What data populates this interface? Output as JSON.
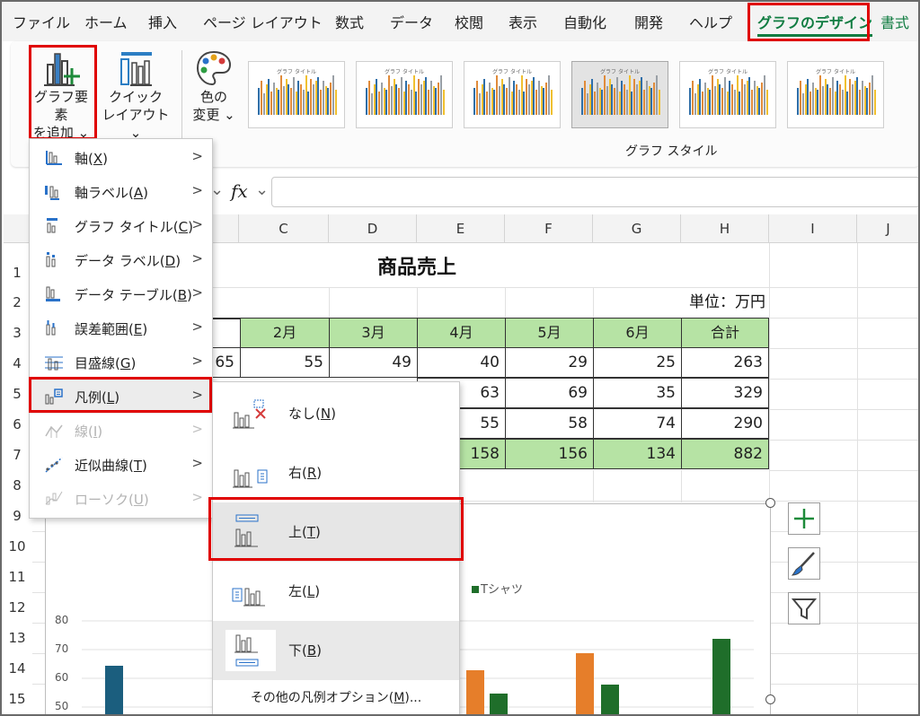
{
  "ribbon_tabs": [
    "ファイル",
    "ホーム",
    "挿入",
    "ページ レイアウト",
    "数式",
    "データ",
    "校閲",
    "表示",
    "自動化",
    "開発",
    "ヘルプ",
    "グラフのデザイン",
    "書式"
  ],
  "ribbon": {
    "add_element": [
      "グラフ要素",
      "を追加 ⌄"
    ],
    "quick_layout": [
      "クイック",
      "レイアウト ⌄"
    ],
    "change_color": [
      "色の",
      "変更 ⌄"
    ],
    "style_group_label": "グラフ スタイル",
    "style_thumb_title": "グラフ タイトル"
  },
  "formula_bar": {
    "fx": "fx"
  },
  "columns": [
    "C",
    "D",
    "E",
    "F",
    "G",
    "H",
    "I",
    "J"
  ],
  "rows": [
    "1",
    "2",
    "3",
    "4",
    "5",
    "6",
    "7",
    "8",
    "9",
    "10",
    "11",
    "12",
    "13",
    "14",
    "15"
  ],
  "sheet": {
    "title": "商品売上",
    "unit": "単位：万円",
    "month_headers": [
      "2月",
      "3月",
      "4月",
      "5月",
      "6月",
      "合計"
    ],
    "row4": [
      "65",
      "55",
      "49",
      "40",
      "29",
      "25",
      "263"
    ],
    "row5": [
      "63",
      "69",
      "35",
      "329"
    ],
    "row6": [
      "55",
      "58",
      "74",
      "290"
    ],
    "row7": [
      "158",
      "156",
      "134",
      "882"
    ]
  },
  "chart": {
    "legend_tshirt": "Tシャツ",
    "y_ticks": [
      "80",
      "70",
      "60",
      "50"
    ],
    "colors": {
      "series1": "#1b5e7e",
      "series2": "#e67e2a",
      "series3": "#1f6e2a"
    }
  },
  "element_menu": {
    "items": [
      {
        "label": "軸(",
        "key": "X",
        "end": ")"
      },
      {
        "label": "軸ラベル(",
        "key": "A",
        "end": ")"
      },
      {
        "label": "グラフ タイトル(",
        "key": "C",
        "end": ")"
      },
      {
        "label": "データ ラベル(",
        "key": "D",
        "end": ")"
      },
      {
        "label": "データ テーブル(",
        "key": "B",
        "end": ")"
      },
      {
        "label": "誤差範囲(",
        "key": "E",
        "end": ")"
      },
      {
        "label": "目盛線(",
        "key": "G",
        "end": ")"
      },
      {
        "label": "凡例(",
        "key": "L",
        "end": ")"
      },
      {
        "label": "線(",
        "key": "I",
        "end": ")"
      },
      {
        "label": "近似曲線(",
        "key": "T",
        "end": ")"
      },
      {
        "label": "ローソク(",
        "key": "U",
        "end": ")"
      }
    ]
  },
  "legend_menu": {
    "items": [
      {
        "label": "なし(",
        "key": "N",
        "end": ")"
      },
      {
        "label": "右(",
        "key": "R",
        "end": ")"
      },
      {
        "label": "上(",
        "key": "T",
        "end": ")"
      },
      {
        "label": "左(",
        "key": "L",
        "end": ")"
      },
      {
        "label": "下(",
        "key": "B",
        "end": ")"
      }
    ],
    "more": {
      "label": "その他の凡例オプション(",
      "key": "M",
      "end": ")..."
    }
  }
}
